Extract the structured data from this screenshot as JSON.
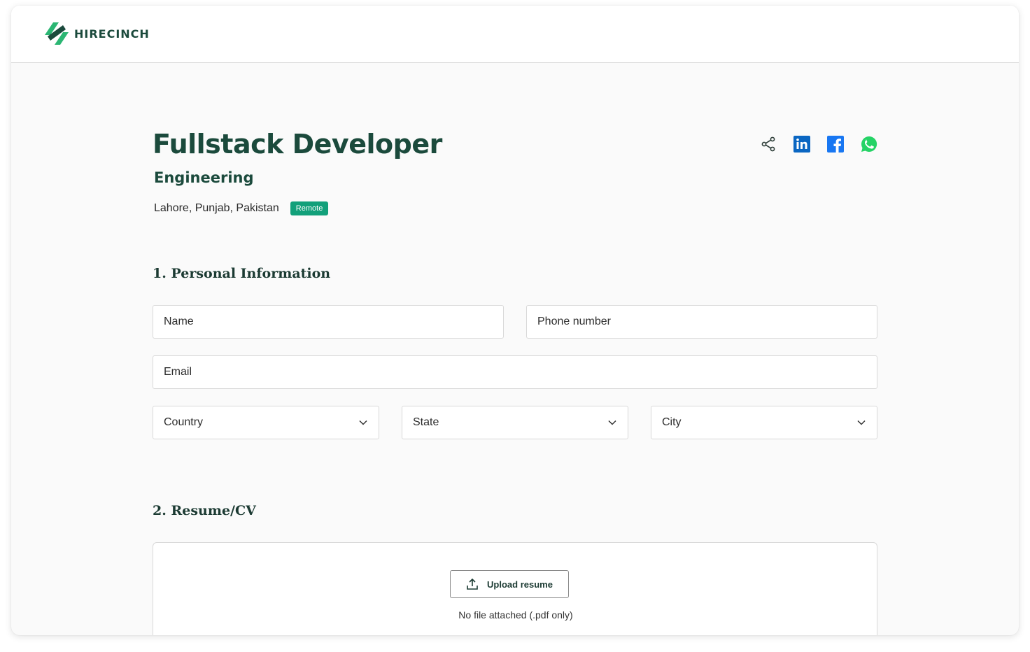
{
  "brand": {
    "name": "HIRECINCH",
    "color": "#1b4a3c",
    "accent": "#2bb673"
  },
  "job": {
    "title": "Fullstack Developer",
    "department": "Engineering",
    "location": "Lahore, Punjab, Pakistan",
    "badge": "Remote",
    "badge_color": "#12a07a"
  },
  "share": {
    "icons": [
      "share-icon",
      "linkedin-icon",
      "facebook-icon",
      "whatsapp-icon"
    ]
  },
  "personal_info": {
    "title": "1. Personal Information",
    "name_placeholder": "Name",
    "phone_placeholder": "Phone number",
    "email_placeholder": "Email",
    "country_label": "Country",
    "state_label": "State",
    "city_label": "City"
  },
  "resume": {
    "title": "2. Resume/CV",
    "upload_label": "Upload resume",
    "note": "No file attached (.pdf only)"
  }
}
